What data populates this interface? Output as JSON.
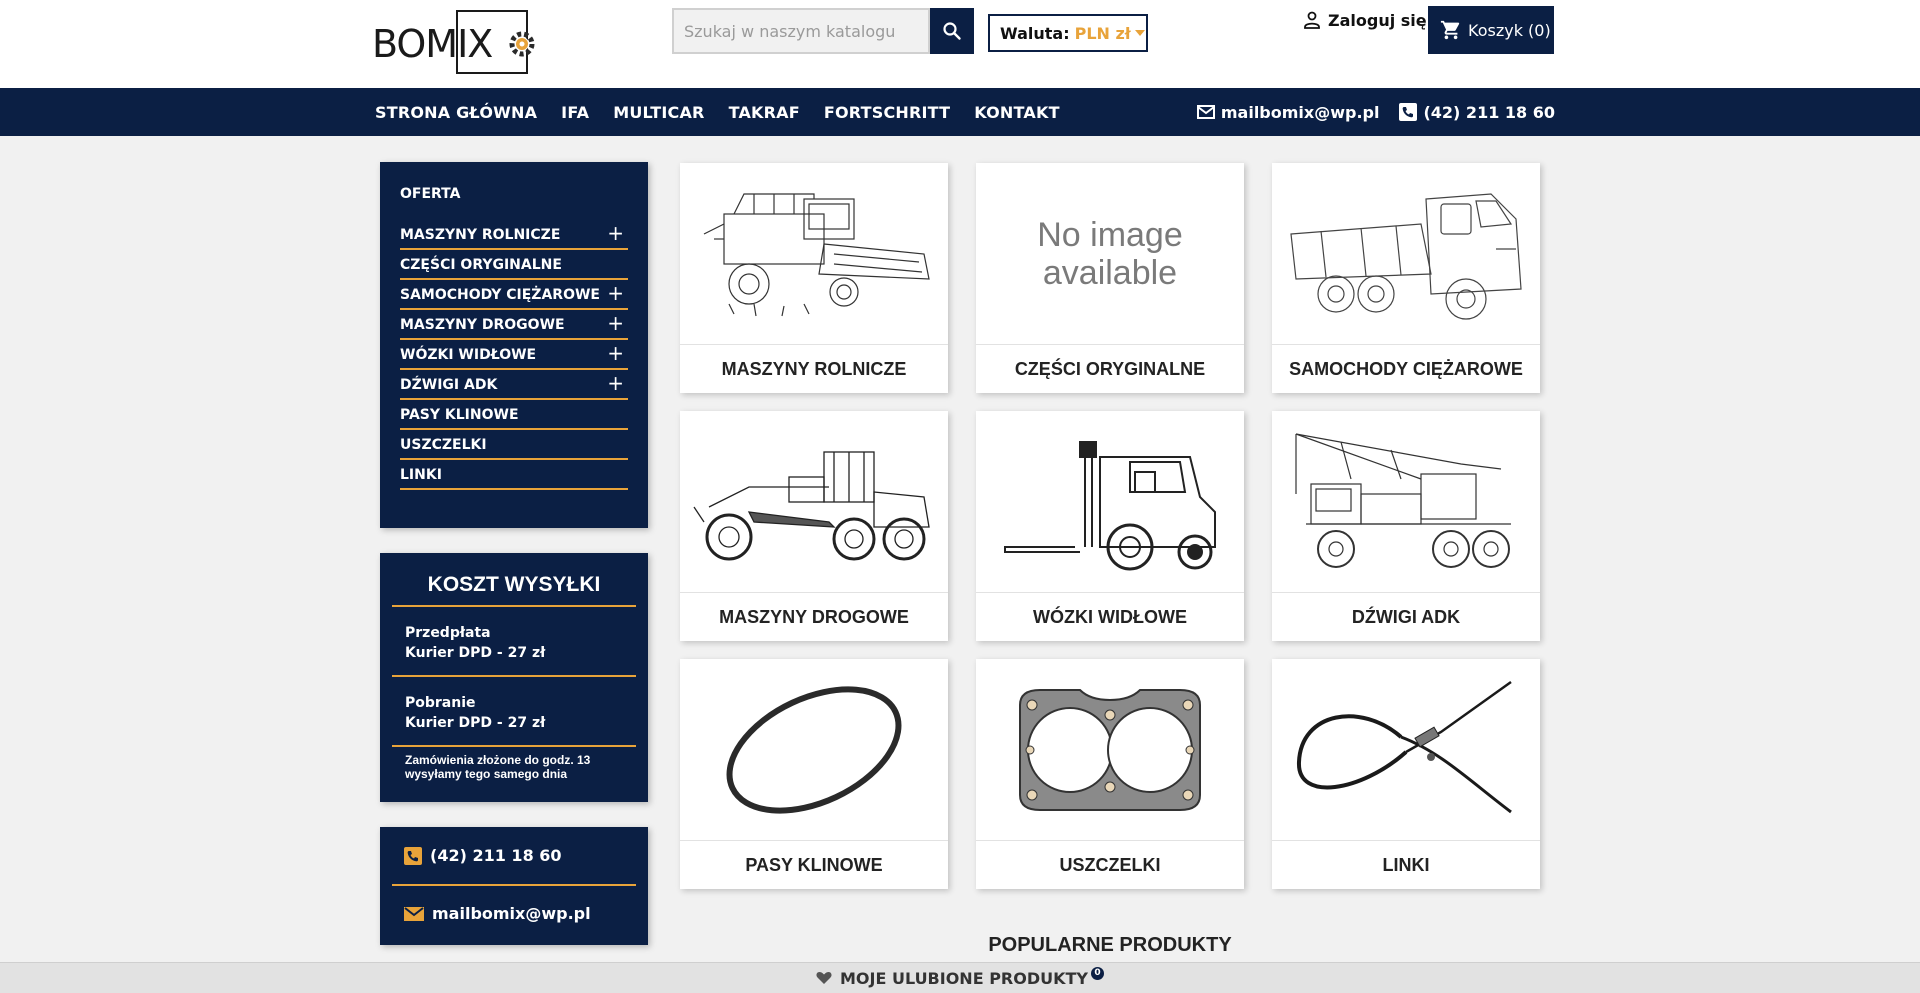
{
  "header": {
    "logo_text": "BOMIX",
    "search": {
      "placeholder": "Szukaj w naszym katalogu",
      "value": ""
    },
    "currency": {
      "label": "Waluta:",
      "value": "PLN zł"
    },
    "login_label": "Zaloguj się",
    "cart_label": "Koszyk (0)"
  },
  "nav": {
    "items": [
      "STRONA GŁÓWNA",
      "IFA",
      "MULTICAR",
      "TAKRAF",
      "FORTSCHRITT",
      "KONTAKT"
    ],
    "email": "mailbomix@wp.pl",
    "phone": "(42) 211 18 60"
  },
  "sidebar": {
    "menu_title": "OFERTA",
    "items": [
      {
        "label": "MASZYNY ROLNICZE",
        "expandable": true
      },
      {
        "label": "CZĘŚCI ORYGINALNE",
        "expandable": false
      },
      {
        "label": "SAMOCHODY CIĘŻAROWE",
        "expandable": true
      },
      {
        "label": "MASZYNY DROGOWE",
        "expandable": true
      },
      {
        "label": "WÓZKI WIDŁOWE",
        "expandable": true
      },
      {
        "label": "DŹWIGI ADK",
        "expandable": true
      },
      {
        "label": "PASY KLINOWE",
        "expandable": false
      },
      {
        "label": "USZCZELKI",
        "expandable": false
      },
      {
        "label": "LINKI",
        "expandable": false
      }
    ],
    "expand_symbol": "+",
    "shipping": {
      "title": "KOSZT WYSYŁKI",
      "rows": [
        {
          "line1": "Przedpłata",
          "line2": "Kurier DPD - 27 zł"
        },
        {
          "line1": "Pobranie",
          "line2": "Kurier DPD - 27 zł"
        }
      ],
      "note_line1": "Zamówienia złożone do godz. 13",
      "note_line2": "wysyłamy tego samego dnia"
    },
    "contact": {
      "phone": "(42) 211 18 60",
      "email": "mailbomix@wp.pl"
    }
  },
  "categories": [
    {
      "label": "MASZYNY ROLNICZE",
      "icon": "combine-harvester-image"
    },
    {
      "label": "CZĘŚCI ORYGINALNE",
      "icon": "no-image-placeholder",
      "placeholder_line1": "No image",
      "placeholder_line2": "available"
    },
    {
      "label": "SAMOCHODY CIĘŻAROWE",
      "icon": "dump-truck-image"
    },
    {
      "label": "MASZYNY DROGOWE",
      "icon": "motor-grader-image"
    },
    {
      "label": "WÓZKI WIDŁOWE",
      "icon": "forklift-image"
    },
    {
      "label": "DŹWIGI ADK",
      "icon": "truck-crane-image"
    },
    {
      "label": "PASY KLINOWE",
      "icon": "v-belt-image"
    },
    {
      "label": "USZCZELKI",
      "icon": "head-gasket-image"
    },
    {
      "label": "LINKI",
      "icon": "cable-image"
    }
  ],
  "popular_title": "POPULARNE PRODUKTY",
  "favorites": {
    "label": "MOJE ULUBIONE PRODUKTY",
    "count": "0"
  },
  "colors": {
    "navy": "#0b1f44",
    "accent": "#e8a33a",
    "background": "#f1f1f1"
  }
}
